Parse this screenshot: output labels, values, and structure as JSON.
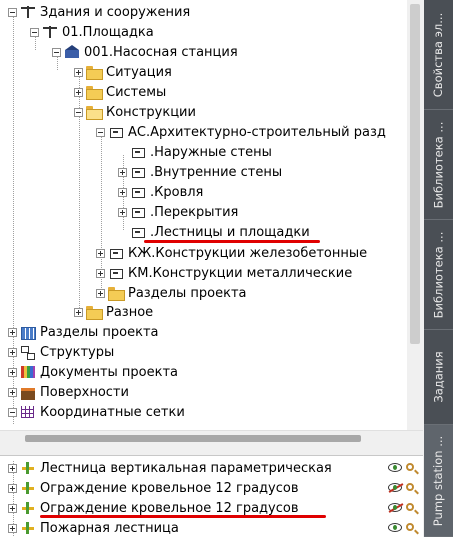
{
  "tree": {
    "items": [
      {
        "label": "Здания и сооружения",
        "icon": "crane-icon",
        "state": "expanded"
      },
      {
        "label": "01.Площадка",
        "icon": "crane-icon",
        "state": "expanded"
      },
      {
        "label": "001.Насосная станция",
        "icon": "house-icon",
        "state": "expanded"
      },
      {
        "label": "Ситуация",
        "icon": "folder-icon",
        "state": "collapsed"
      },
      {
        "label": "Системы",
        "icon": "folder-icon",
        "state": "collapsed"
      },
      {
        "label": "Конструкции",
        "icon": "folder-open-icon",
        "state": "expanded"
      },
      {
        "label": "АС.Архитектурно-строительный разд",
        "icon": "part-icon",
        "state": "expanded"
      },
      {
        "label": ".Наружные стены",
        "icon": "part-icon",
        "state": "leaf"
      },
      {
        "label": ".Внутренние стены",
        "icon": "part-icon",
        "state": "collapsed"
      },
      {
        "label": ".Кровля",
        "icon": "part-icon",
        "state": "collapsed"
      },
      {
        "label": ".Перекрытия",
        "icon": "part-icon",
        "state": "collapsed"
      },
      {
        "label": ".Лестницы и площадки",
        "icon": "part-icon",
        "state": "leaf",
        "highlighted": true
      },
      {
        "label": "КЖ.Конструкции железобетонные",
        "icon": "part-icon",
        "state": "collapsed"
      },
      {
        "label": "КМ.Конструкции металлические",
        "icon": "part-icon",
        "state": "collapsed"
      },
      {
        "label": "Разделы проекта",
        "icon": "folder-icon",
        "state": "collapsed"
      },
      {
        "label": "Разное",
        "icon": "folder-icon",
        "state": "collapsed"
      },
      {
        "label": "Разделы проекта",
        "icon": "grid-blue-icon",
        "state": "collapsed"
      },
      {
        "label": "Структуры",
        "icon": "structure-icon",
        "state": "collapsed"
      },
      {
        "label": "Документы проекта",
        "icon": "books-icon",
        "state": "collapsed"
      },
      {
        "label": "Поверхности",
        "icon": "surface-icon",
        "state": "collapsed"
      },
      {
        "label": "Координатные сетки",
        "icon": "coord-grid-icon",
        "state": "expanded"
      }
    ]
  },
  "list": {
    "items": [
      {
        "label": "Лестница вертикальная параметрическая",
        "visible": true
      },
      {
        "label": "Ограждение кровельное 12 градусов",
        "visible": false
      },
      {
        "label": "Ограждение кровельное 12 градусов",
        "visible": false,
        "highlighted": true
      },
      {
        "label": "Пожарная лестница",
        "visible": true
      }
    ]
  },
  "side_tabs": [
    {
      "label": "Свойства эл..."
    },
    {
      "label": "Библиотека ..."
    },
    {
      "label": "Библиотека ..."
    },
    {
      "label": "Задания"
    },
    {
      "label": "Pump station ...",
      "active": true
    }
  ],
  "colors": {
    "highlight_underline": "#e00000",
    "side_panel": "#4a4f55"
  }
}
